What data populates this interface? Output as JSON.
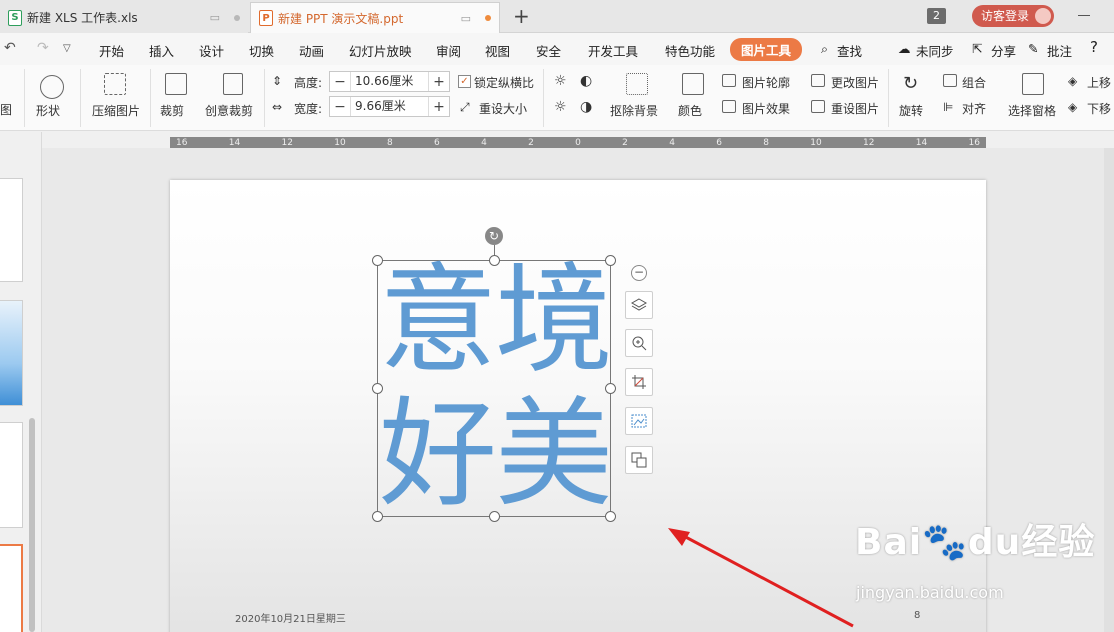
{
  "tabs": [
    {
      "label": "新建 XLS 工作表.xls",
      "icon": "xls-icon"
    },
    {
      "label": "新建 PPT 演示文稿.ppt",
      "icon": "ppt-icon"
    }
  ],
  "titlebar": {
    "window_count": "2",
    "login": "访客登录"
  },
  "menu": {
    "items": [
      "开始",
      "插入",
      "设计",
      "切换",
      "动画",
      "幻灯片放映",
      "审阅",
      "视图",
      "安全",
      "开发工具",
      "特色功能",
      "图片工具",
      "查找"
    ],
    "active": "图片工具",
    "right": [
      "未同步",
      "分享",
      "批注",
      "?"
    ]
  },
  "ribbon": {
    "shape": "形状",
    "compress": "压缩图片",
    "crop": "裁剪",
    "creative_crop": "创意裁剪",
    "height_label": "高度:",
    "height_value": "10.66厘米",
    "width_label": "宽度:",
    "width_value": "9.66厘米",
    "lock_ratio": "锁定纵横比",
    "reset_size": "重设大小",
    "remove_bg": "抠除背景",
    "color": "颜色",
    "outline": "图片轮廓",
    "effects": "图片效果",
    "change_pic": "更改图片",
    "reset_pic": "重设图片",
    "group": "组合",
    "rotate": "旋转",
    "align": "对齐",
    "select_pane": "选择窗格",
    "move_up": "上移",
    "move_down": "下移"
  },
  "ruler": {
    "ticks": [
      "16",
      "14",
      "12",
      "10",
      "8",
      "6",
      "4",
      "2",
      "0",
      "2",
      "4",
      "6",
      "8",
      "10",
      "12",
      "14",
      "16"
    ]
  },
  "slide": {
    "line1": "意境",
    "line2": "好美",
    "text_color": "#5f9bd3",
    "footer_date": "2020年10月21日星期三",
    "page_number": "8"
  },
  "watermark": {
    "brand": "Bai",
    "brand2": "du",
    "brand_cn": "经验",
    "url": "jingyan.baidu.com"
  },
  "colors": {
    "accent": "#ec7a45",
    "login": "#d05a4e",
    "arrow": "#e02020"
  }
}
